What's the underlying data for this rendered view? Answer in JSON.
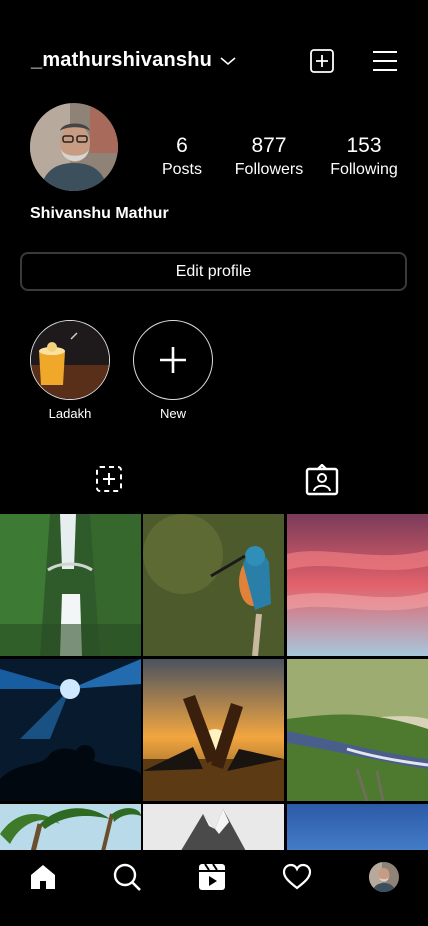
{
  "header": {
    "username": "_mathurshivanshu"
  },
  "profile": {
    "stats": [
      {
        "value": "6",
        "label": "Posts"
      },
      {
        "value": "877",
        "label": "Followers"
      },
      {
        "value": "153",
        "label": "Following"
      }
    ],
    "full_name": "Shivanshu Mathur",
    "edit_label": "Edit profile"
  },
  "highlights": [
    {
      "label": "Ladakh"
    },
    {
      "label": "New"
    }
  ],
  "icons": {
    "header": [
      "chevron-down-icon",
      "new-post-icon",
      "menu-icon"
    ],
    "tabs": [
      "grid-posts-icon",
      "tagged-icon"
    ],
    "nav": [
      "home-icon",
      "search-icon",
      "reels-icon",
      "heart-icon",
      "profile-avatar"
    ]
  }
}
